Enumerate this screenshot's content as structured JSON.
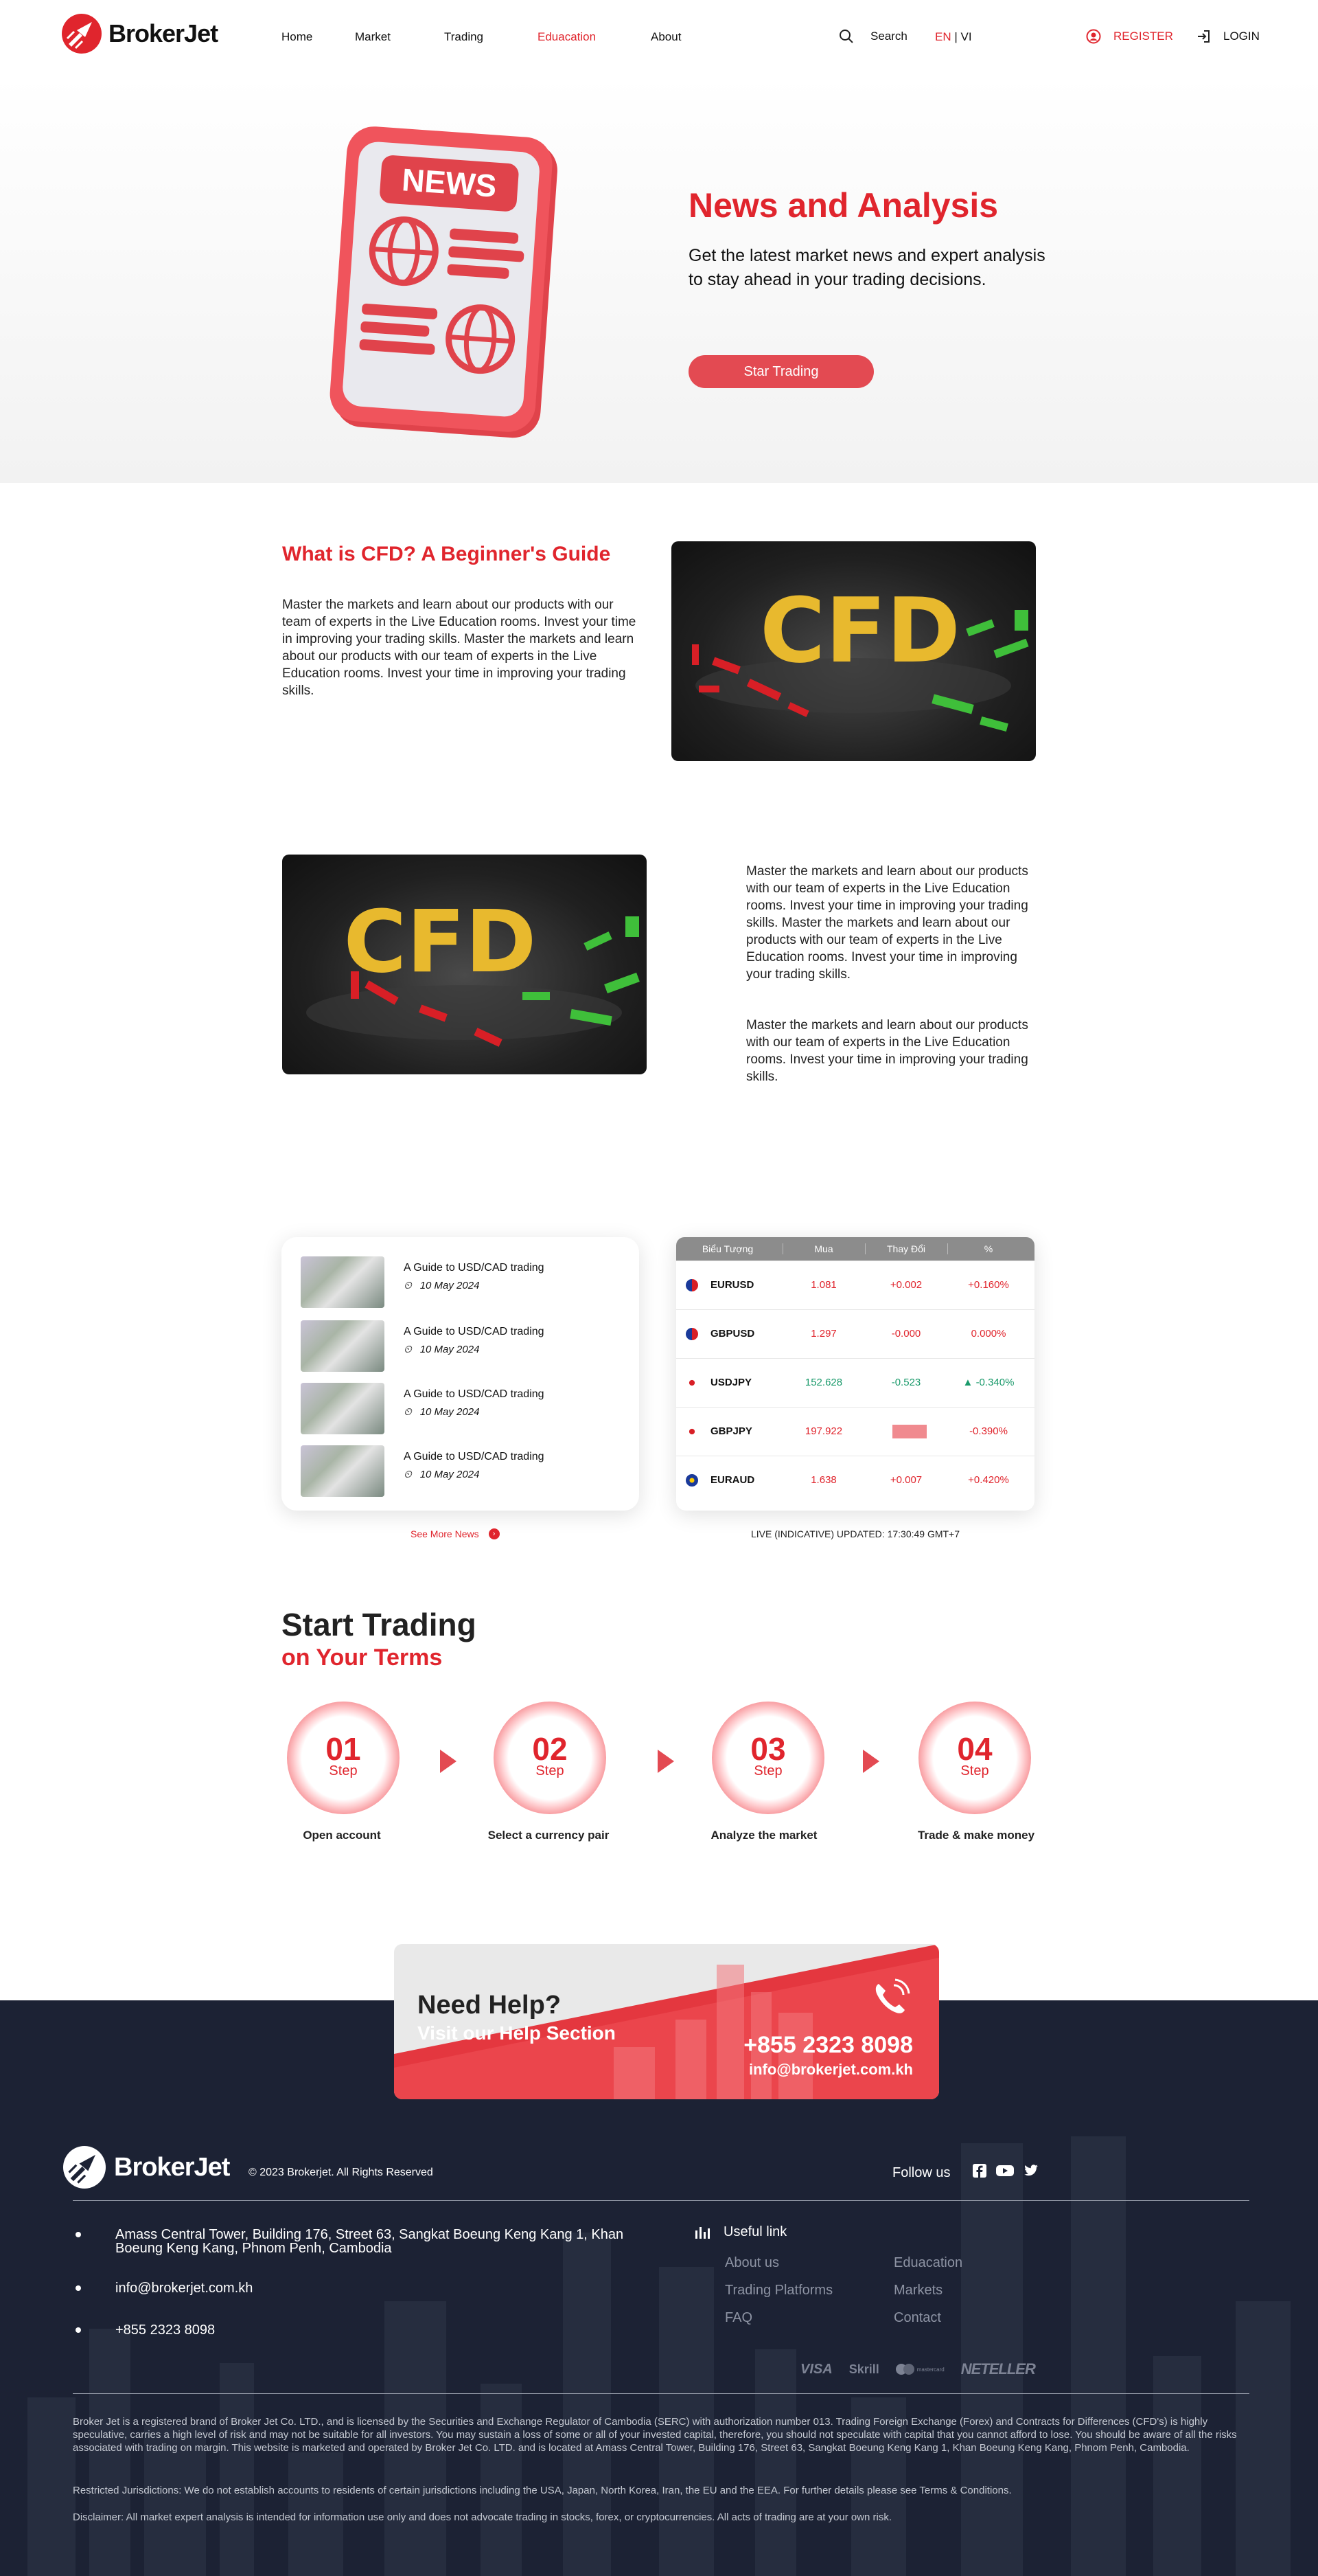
{
  "header": {
    "brand": "BrokerJet",
    "nav": [
      "Home",
      "Market",
      "Trading",
      "Eduacation",
      "About"
    ],
    "search_label": "Search",
    "lang_en": "EN",
    "lang_sep": " | ",
    "lang_vi": "VI",
    "register": "REGISTER",
    "login": "LOGIN"
  },
  "hero": {
    "badge": "NEWS",
    "title": "News and Analysis",
    "subtitle": "Get the latest market news and expert analysis to stay ahead in your trading decisions.",
    "cta": "Star Trading"
  },
  "cfd1": {
    "title": "What is CFD? A Beginner's Guide",
    "text": "Master the markets and learn about our products with our team of experts in the Live Education rooms. Invest your time in improving your trading skills. Master the markets and learn about our products with our team of experts in the Live Education rooms. Invest your time in improving your trading skills.",
    "image_text": "CFD"
  },
  "cfd2": {
    "image_text": "CFD",
    "text1": "Master the markets and learn about our products with our team of experts in the Live Education rooms. Invest your time in improving your trading skills. Master the markets and learn about our products with our team of experts in the Live Education rooms. Invest your time in improving your trading skills.",
    "text2": "Master the markets and learn about our products with our team of experts in the Live Education rooms. Invest your time in improving your trading skills."
  },
  "news": {
    "items": [
      {
        "title": "A Guide to USD/CAD trading",
        "date": "10 May 2024"
      },
      {
        "title": "A Guide to USD/CAD trading",
        "date": "10 May 2024"
      },
      {
        "title": "A Guide to USD/CAD trading",
        "date": "10 May 2024"
      },
      {
        "title": "A Guide to USD/CAD trading",
        "date": "10 May 2024"
      }
    ],
    "see_more": "See More News"
  },
  "quotes": {
    "headers": [
      "Biểu Tượng",
      "Mua",
      "Thay Đổi",
      "%"
    ],
    "rows": [
      {
        "symbol": "EURUSD",
        "buy": "1.081",
        "change": "+0.002",
        "pct": "+0.160%"
      },
      {
        "symbol": "GBPUSD",
        "buy": "1.297",
        "change": "-0.000",
        "pct": "0.000%"
      },
      {
        "symbol": "USDJPY",
        "buy": "152.628",
        "change": "-0.523",
        "pct": "-0.340%"
      },
      {
        "symbol": "GBPJPY",
        "buy": "197.922",
        "change": "",
        "pct": "-0.390%"
      },
      {
        "symbol": "EURAUD",
        "buy": "1.638",
        "change": "+0.007",
        "pct": "+0.420%"
      }
    ],
    "updated": "LIVE (INDICATIVE) UPDATED: 17:30:49 GMT+7",
    "colors": {
      "red": "#e0252d",
      "green": "#1a9a6b"
    }
  },
  "start": {
    "title": "Start Trading",
    "subtitle": "on Your Terms",
    "step_word": "Step",
    "steps": [
      {
        "num": "01",
        "label": "Open account"
      },
      {
        "num": "02",
        "label": "Select a currency pair"
      },
      {
        "num": "03",
        "label": "Analyze the market"
      },
      {
        "num": "04",
        "label": "Trade & make money"
      }
    ]
  },
  "help": {
    "title": "Need Help?",
    "subtitle": "Visit our Help Section",
    "phone": "+855 2323 8098",
    "email": "info@brokerjet.com.kh"
  },
  "footer": {
    "brand": "BrokerJet",
    "copyright": "© 2023 Brokerjet. All Rights Reserved",
    "follow": "Follow us",
    "address": "Amass Central Tower, Building 176, Street 63, Sangkat Boeung Keng Kang 1, Khan Boeung Keng Kang, Phnom Penh, Cambodia",
    "email": "info@brokerjet.com.kh",
    "phone": "+855 2323 8098",
    "useful_title": "Useful link",
    "links_left": [
      "About us",
      "Trading Platforms",
      "FAQ"
    ],
    "links_right": [
      "Eduacation",
      "Markets",
      "Contact"
    ],
    "payments": [
      "VISA",
      "Skrill",
      "mastercard",
      "NETELLER"
    ],
    "legal1": "Broker Jet is a registered brand of Broker Jet Co. LTD., and is licensed by the Securities and Exchange Regulator of Cambodia (SERC) with authorization number 013. Trading Foreign Exchange (Forex) and Contracts for Differences (CFD's) is highly speculative, carries a high level of risk and may not be suitable for all investors. You may sustain a loss of some or all of your invested capital, therefore, you should not speculate with capital that you cannot afford to lose. You should be aware of all the risks associated with trading on margin. This website is marketed and operated by Broker Jet Co. LTD. and is located at Amass Central Tower, Building 176, Street 63, Sangkat Boeung Keng Kang 1, Khan Boeung Keng Kang, Phnom Penh, Cambodia.",
    "legal2": "Restricted Jurisdictions: We do not establish accounts to residents of certain jurisdictions including the USA, Japan, North Korea, Iran, the EU and the EEA. For further details please see Terms & Conditions.",
    "legal3": "Disclaimer: All market expert analysis is intended for information use only and does not advocate trading in stocks, forex, or cryptocurrencies. All acts of trading are at your own risk."
  }
}
